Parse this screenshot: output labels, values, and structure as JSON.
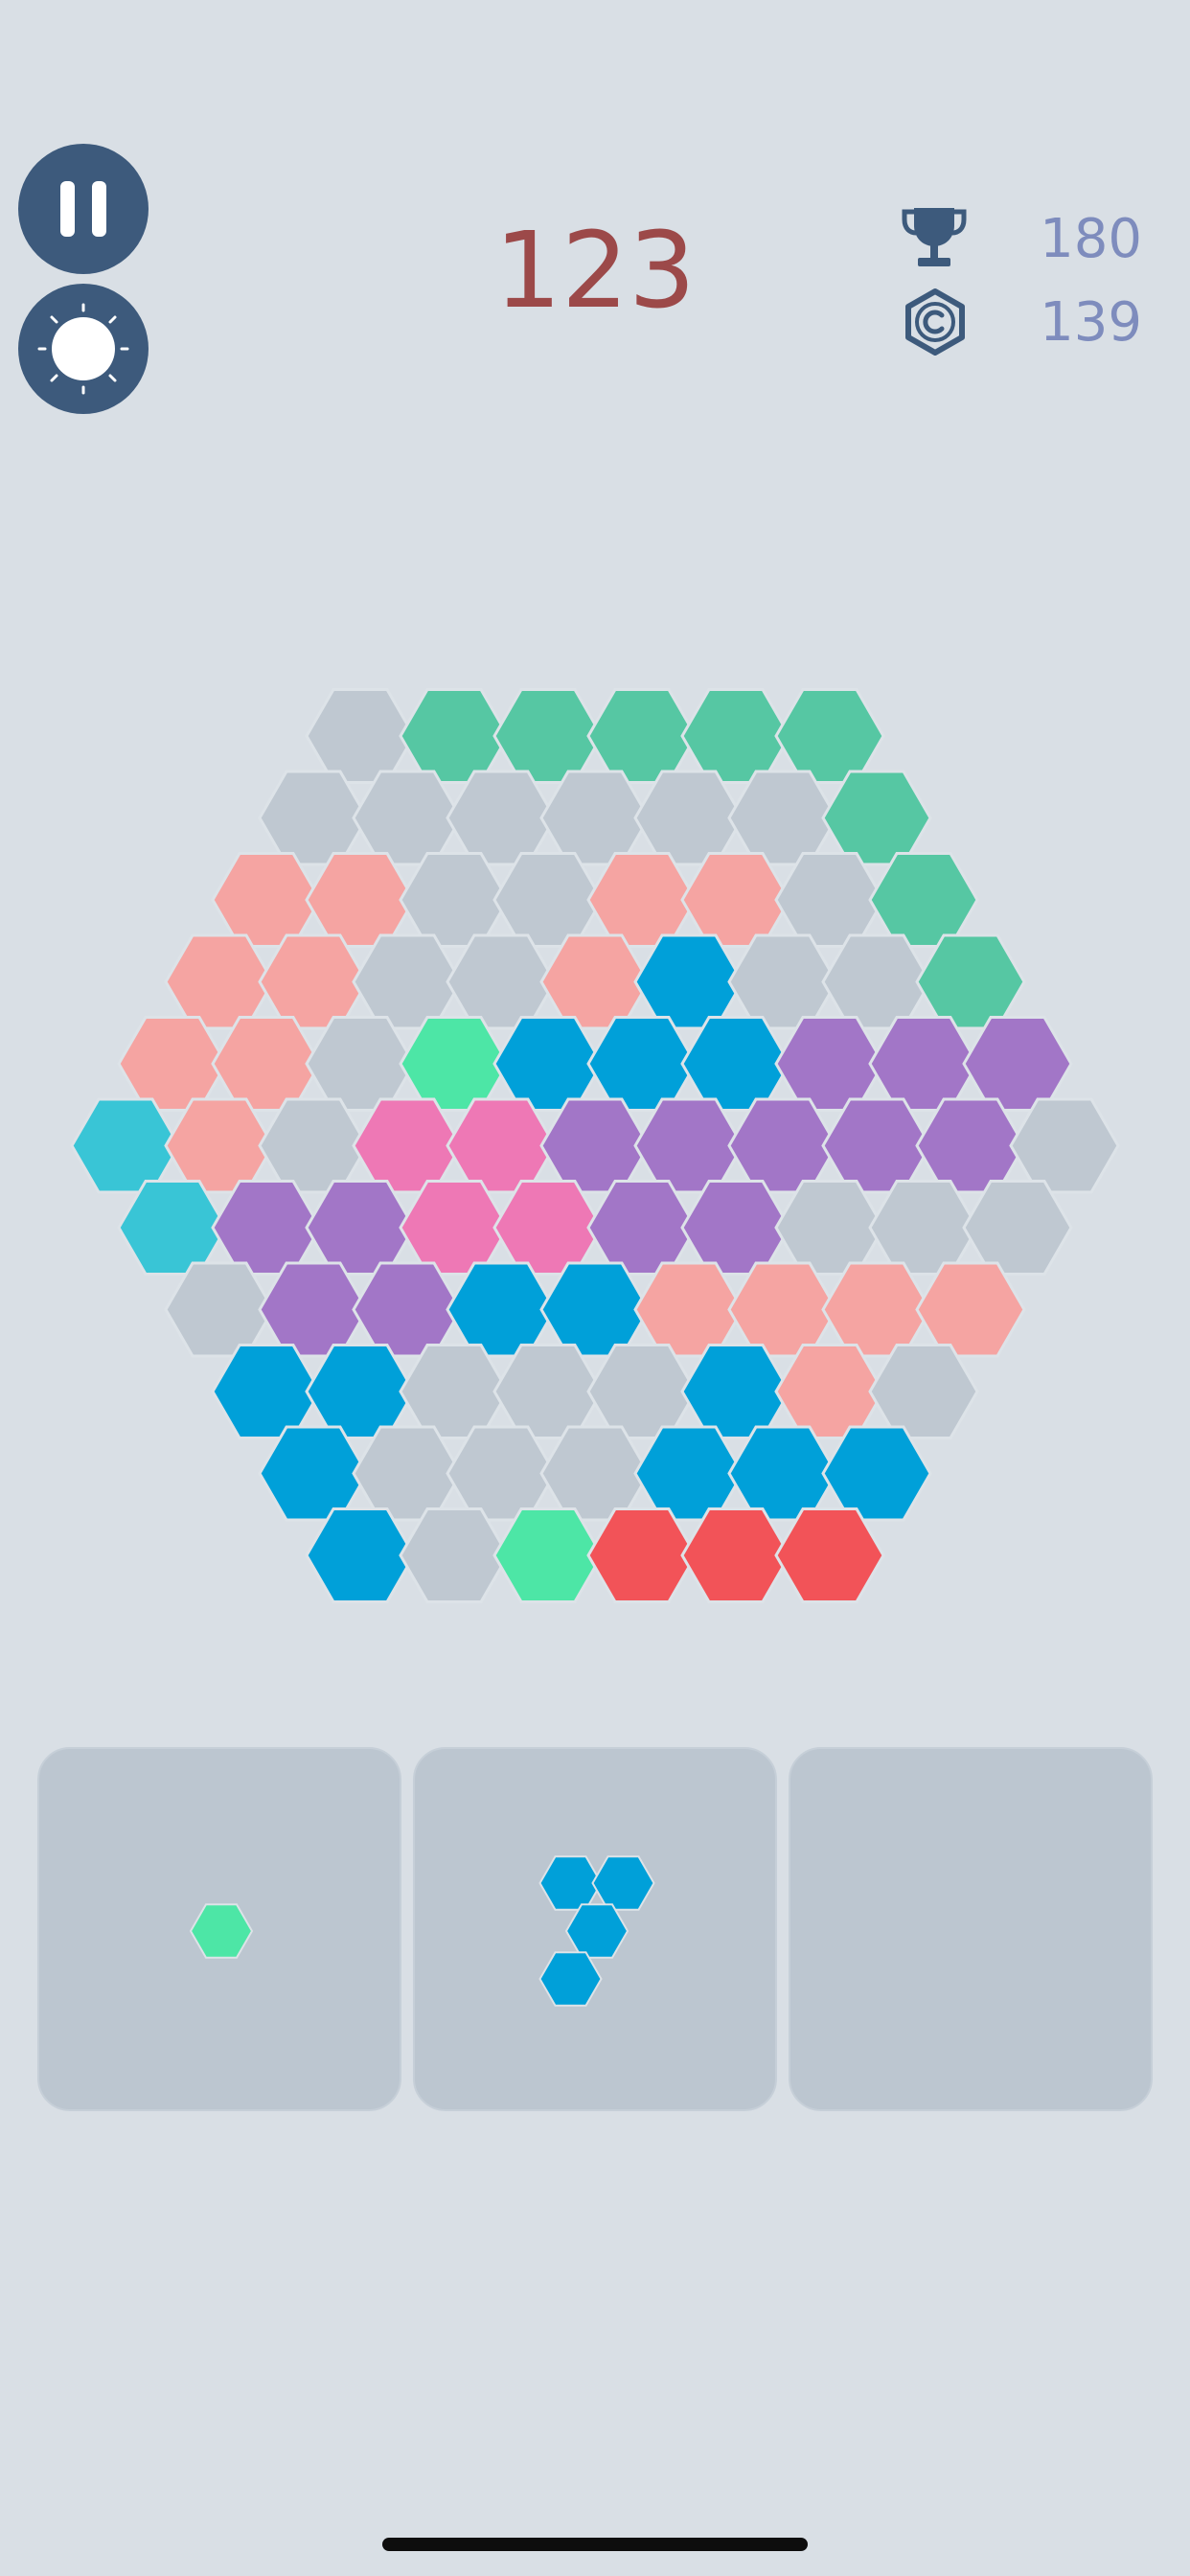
{
  "hud": {
    "score": "123",
    "best_score": "180",
    "coins": "139",
    "pause_icon": "pause-icon",
    "theme_icon": "sun-icon",
    "best_icon": "trophy-icon",
    "coins_icon": "coin-icon"
  },
  "colors": {
    "empty": "#bfc8d1",
    "green": "#56c7a3",
    "mint": "#4de6a6",
    "salmon": "#f5a4a2",
    "blue": "#00a0d9",
    "purple": "#a276c7",
    "pink": "#ee78b5",
    "cyan": "#39c5d6",
    "red": "#f25358",
    "button": "#3d5a7c",
    "score": "#9c4949",
    "stat": "#7e8cbd"
  },
  "board": {
    "rows": [
      [
        "empty",
        "green",
        "green",
        "green",
        "green",
        "green"
      ],
      [
        "empty",
        "empty",
        "empty",
        "empty",
        "empty",
        "empty",
        "green"
      ],
      [
        "salmon",
        "salmon",
        "empty",
        "empty",
        "salmon",
        "salmon",
        "empty",
        "green"
      ],
      [
        "salmon",
        "salmon",
        "empty",
        "empty",
        "salmon",
        "blue",
        "empty",
        "empty",
        "green"
      ],
      [
        "salmon",
        "salmon",
        "empty",
        "mint",
        "blue",
        "blue",
        "blue",
        "purple",
        "purple",
        "purple"
      ],
      [
        "cyan",
        "salmon",
        "empty",
        "pink",
        "pink",
        "purple",
        "purple",
        "purple",
        "purple",
        "purple",
        "empty"
      ],
      [
        "cyan",
        "purple",
        "purple",
        "pink",
        "pink",
        "purple",
        "purple",
        "empty",
        "empty",
        "empty"
      ],
      [
        "empty",
        "purple",
        "purple",
        "blue",
        "blue",
        "salmon",
        "salmon",
        "salmon",
        "salmon"
      ],
      [
        "blue",
        "blue",
        "empty",
        "empty",
        "empty",
        "blue",
        "salmon",
        "empty"
      ],
      [
        "blue",
        "empty",
        "empty",
        "empty",
        "blue",
        "blue",
        "blue"
      ],
      [
        "blue",
        "empty",
        "mint",
        "red",
        "red",
        "red"
      ]
    ]
  },
  "trays": [
    {
      "piece": [
        [
          0,
          0
        ]
      ],
      "color": "mint"
    },
    {
      "piece": [
        [
          0,
          0
        ],
        [
          1,
          0
        ],
        [
          0,
          1
        ],
        [
          0,
          2
        ]
      ],
      "color": "blue"
    },
    {
      "piece": [],
      "color": ""
    }
  ]
}
